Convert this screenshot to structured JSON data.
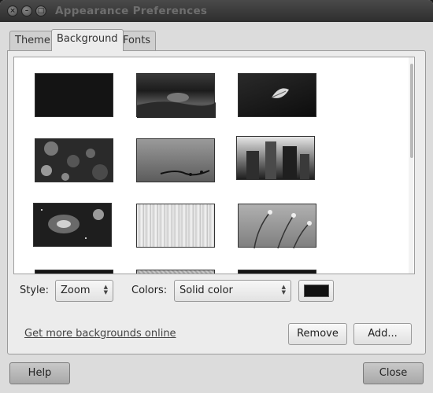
{
  "window": {
    "title": "Appearance Preferences",
    "controls": [
      "close-icon",
      "minimize-icon",
      "maximize-icon"
    ]
  },
  "tabs": [
    {
      "label": "Theme",
      "active": false
    },
    {
      "label": "Background",
      "active": true
    },
    {
      "label": "Fonts",
      "active": false
    }
  ],
  "backgrounds": [
    {
      "name": "solid-black",
      "stacked": false
    },
    {
      "name": "dark-cloudy-landscape",
      "stacked": false
    },
    {
      "name": "dark-leaf",
      "stacked": false
    },
    {
      "name": "bubbles-bokeh",
      "stacked": false
    },
    {
      "name": "twig-silhouette",
      "stacked": false
    },
    {
      "name": "skyscrapers",
      "stacked": true
    },
    {
      "name": "spiral-galaxy",
      "stacked": true
    },
    {
      "name": "light-curtain",
      "stacked": false
    },
    {
      "name": "flower-stems",
      "stacked": false
    }
  ],
  "style": {
    "label": "Style:",
    "value": "Zoom"
  },
  "colors": {
    "label": "Colors:",
    "value": "Solid color",
    "swatch": "#111111"
  },
  "links": {
    "more_backgrounds": "Get more backgrounds online"
  },
  "buttons": {
    "remove": "Remove",
    "add": "Add...",
    "help": "Help",
    "close": "Close"
  },
  "theme": {
    "window_bg": "#dcdcdc",
    "titlebar": "#3a3a3a"
  }
}
